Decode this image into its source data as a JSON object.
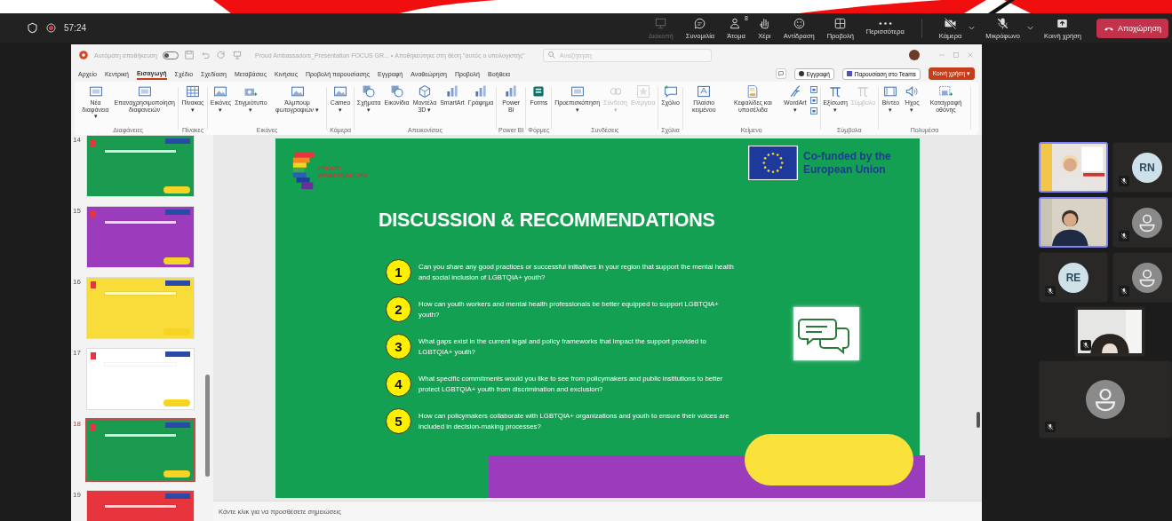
{
  "call_bar": {
    "timer": "57:24",
    "buttons": [
      {
        "label": "Διακοπή",
        "disabled": true,
        "split": false
      },
      {
        "label": "Συνομιλία",
        "disabled": false,
        "split": false
      },
      {
        "label": "Άτομα",
        "disabled": false,
        "badge": "8",
        "split": false
      },
      {
        "label": "Χέρι",
        "disabled": false,
        "split": false
      },
      {
        "label": "Αντίδραση",
        "disabled": false,
        "split": false
      },
      {
        "label": "Προβολή",
        "disabled": false,
        "split": false
      },
      {
        "label": "Περισσότερα",
        "disabled": false,
        "split": false
      },
      {
        "label": "Κάμερα",
        "disabled": false,
        "split": true
      },
      {
        "label": "Μικρόφωνο",
        "disabled": false,
        "split": true
      },
      {
        "label": "Κοινή χρήση",
        "disabled": false,
        "split": false
      }
    ],
    "leave": "Αποχώρηση"
  },
  "powerpoint": {
    "title_bar": {
      "autosave": {
        "label": "Αυτόματη αποθήκευση",
        "on": false
      },
      "file_name": "Proud Ambassadors_Presentation FOCUS GR... • Αποθηκεύτηκε στη θέση \"αυτός ο υπολογιστής\"",
      "search": {
        "placeholder": "Αναζήτηση"
      }
    },
    "tabs": [
      {
        "label": "Αρχείο",
        "selected": false
      },
      {
        "label": "Κεντρική",
        "selected": false
      },
      {
        "label": "Εισαγωγή",
        "selected": true
      },
      {
        "label": "Σχέδιο",
        "selected": false
      },
      {
        "label": "Σχεδίαση",
        "selected": false
      },
      {
        "label": "Μεταβάσεις",
        "selected": false
      },
      {
        "label": "Κινήσεις",
        "selected": false
      },
      {
        "label": "Προβολή παρουσίασης",
        "selected": false
      },
      {
        "label": "Εγγραφή",
        "selected": false
      },
      {
        "label": "Αναθεώρηση",
        "selected": false
      },
      {
        "label": "Προβολή",
        "selected": false
      },
      {
        "label": "Βοήθεια",
        "selected": false
      }
    ],
    "record_button": "Εγγραφή",
    "teams_button": "Παρουσίαση στο Teams",
    "share_button": "Κοινή χρήση ▾",
    "ribbon": [
      {
        "label": "Διαφάνειες",
        "items": [
          {
            "label": "Νέα διαφάνεια ▾",
            "disabled": false
          },
          {
            "label": "Επαναχρησιμοποίηση διαφανειών",
            "disabled": false
          }
        ]
      },
      {
        "label": "Πίνακες",
        "items": [
          {
            "label": "Πίνακας ▾",
            "disabled": false
          }
        ]
      },
      {
        "label": "Εικόνες",
        "items": [
          {
            "label": "Εικόνες ▾",
            "disabled": false
          },
          {
            "label": "Στιγμιότυπο ▾",
            "disabled": false
          },
          {
            "label": "Άλμπουμ φωτογραφιών ▾",
            "disabled": false
          }
        ]
      },
      {
        "label": "Κάμερα",
        "items": [
          {
            "label": "Cameo ▾",
            "disabled": false
          }
        ]
      },
      {
        "label": "Απεικονίσεις",
        "items": [
          {
            "label": "Σχήματα ▾",
            "disabled": false
          },
          {
            "label": "Εικονίδια",
            "disabled": false
          },
          {
            "label": "Μοντέλα 3D ▾",
            "disabled": false
          },
          {
            "label": "SmartArt",
            "disabled": false
          },
          {
            "label": "Γράφημα",
            "disabled": false
          }
        ]
      },
      {
        "label": "Power BI",
        "items": [
          {
            "label": "Power BI",
            "disabled": false
          }
        ]
      },
      {
        "label": "Φόρμες",
        "items": [
          {
            "label": "Forms",
            "disabled": false
          }
        ]
      },
      {
        "label": "Συνδέσεις",
        "items": [
          {
            "label": "Προεπισκόπηση ▾",
            "disabled": false
          },
          {
            "label": "Σύνδεση ▾",
            "disabled": true
          },
          {
            "label": "Ενέργεια",
            "disabled": true
          }
        ]
      },
      {
        "label": "Σχόλια",
        "items": [
          {
            "label": "Σχόλιο",
            "disabled": false
          }
        ]
      },
      {
        "label": "Κείμενο",
        "items": [
          {
            "label": "Πλαίσιο κειμένου",
            "disabled": false
          },
          {
            "label": "Κεφαλίδες και υποσέλιδα",
            "disabled": false
          },
          {
            "label": "WordArt ▾",
            "disabled": false
          }
        ]
      },
      {
        "label": "Σύμβολα",
        "items": [
          {
            "label": "Εξίσωση ▾",
            "disabled": false
          },
          {
            "label": "Σύμβολο",
            "disabled": true
          }
        ]
      },
      {
        "label": "Πολυμέσα",
        "items": [
          {
            "label": "Βίντεο ▾",
            "disabled": false
          },
          {
            "label": "Ήχος ▾",
            "disabled": false
          },
          {
            "label": "Καταγραφή οθόνης",
            "disabled": false
          }
        ]
      }
    ],
    "thumbnails": [
      {
        "number": "14",
        "color": "#1a9b50",
        "selected": false
      },
      {
        "number": "15",
        "color": "#9a3cbb",
        "selected": false
      },
      {
        "number": "16",
        "color": "#f7dc3a",
        "selected": false
      },
      {
        "number": "17",
        "color": "#ffffff",
        "selected": false
      },
      {
        "number": "18",
        "color": "#1a9b50",
        "selected": true
      },
      {
        "number": "19",
        "color": "#e8343c",
        "selected": false
      }
    ],
    "slide": {
      "logo_text": "PROUD AMBASSADORS",
      "funding": "Co-funded by the European Union",
      "title": "DISCUSSION & RECOMMENDATIONS",
      "questions": [
        {
          "number": "1",
          "text": "Can you share any good practices or successful initiatives in your region that support the mental health and social inclusion of LGBTQIA+ youth?"
        },
        {
          "number": "2",
          "text": "How can youth workers and mental health professionals be better equipped to support LGBTQIA+ youth?"
        },
        {
          "number": "3",
          "text": "What gaps exist in the current legal and policy frameworks that impact the support provided to LGBTQIA+ youth?"
        },
        {
          "number": "4",
          "text": "What specific commitments would you like to see from policymakers and public institutions to better protect LGBTQIA+ youth from discrimination and exclusion?"
        },
        {
          "number": "5",
          "text": "How can policymakers collaborate with LGBTQIA+ organizations and youth to ensure their voices are included in decision-making processes?"
        }
      ]
    },
    "notes": {
      "placeholder": "Κάντε κλικ για να προσθέσετε σημειώσεις"
    }
  },
  "participants": [
    {
      "kind": "video",
      "highlighted": true,
      "muted": false
    },
    {
      "kind": "initials",
      "initials": "RN",
      "highlighted": false,
      "muted": true
    },
    {
      "kind": "video",
      "highlighted": true,
      "muted": false
    },
    {
      "kind": "avatar",
      "highlighted": false,
      "muted": true
    },
    {
      "kind": "initials",
      "initials": "RE",
      "highlighted": false,
      "muted": true
    },
    {
      "kind": "avatar",
      "highlighted": false,
      "muted": true
    },
    {
      "kind": "video",
      "highlighted": false,
      "muted": true
    },
    {
      "kind": "avatar",
      "highlighted": false,
      "muted": true
    }
  ]
}
